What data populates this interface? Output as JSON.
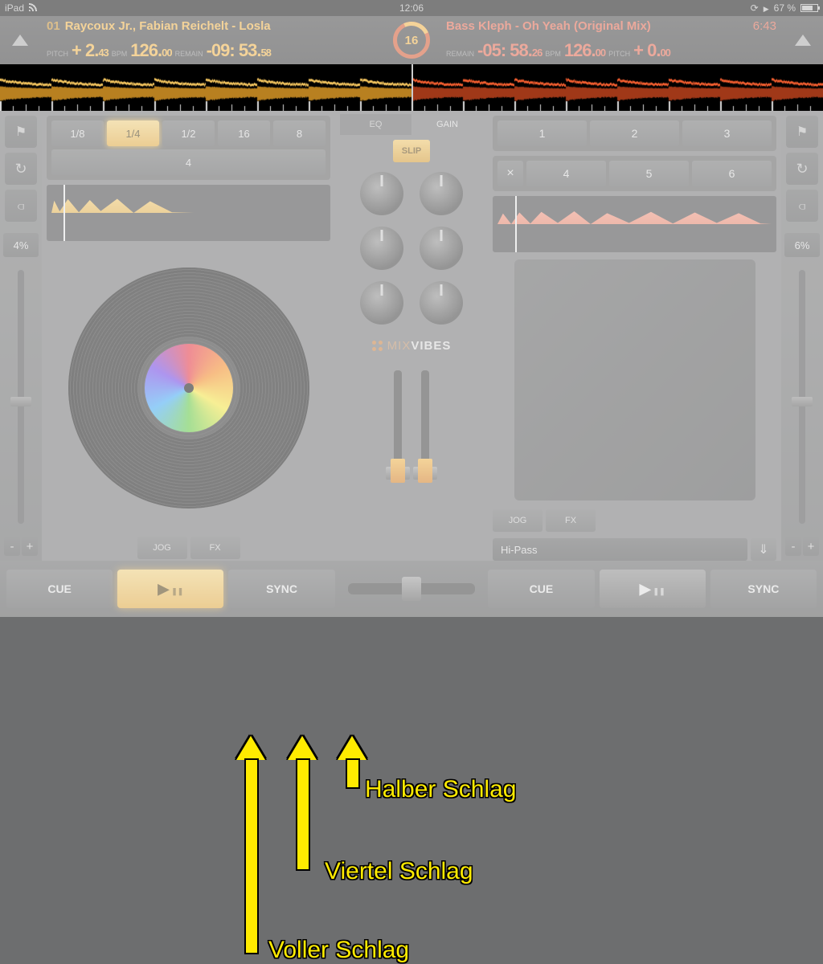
{
  "status": {
    "device": "iPad",
    "time": "12:06",
    "battery": "67 %"
  },
  "deckA": {
    "num": "01",
    "track": "Raycoux Jr., Fabian Reichelt - Losla",
    "pitch_lbl": "PITCH",
    "pitch": "+ 2.",
    "pitch_dec": "43",
    "bpm_lbl": "BPM",
    "bpm": "126.",
    "bpm_dec": "00",
    "remain_lbl": "REMAIN",
    "remain": "-09: 53.",
    "remain_dec": "58",
    "pct": "4%"
  },
  "deckB": {
    "track": "Bass Kleph - Oh Yeah (Original Mix)",
    "dur": "6:43",
    "remain_lbl": "REMAIN",
    "remain": "-05: 58.",
    "remain_dec": "26",
    "bpm_lbl": "BPM",
    "bpm": "126.",
    "bpm_dec": "00",
    "pitch_lbl": "PITCH",
    "pitch": "+ 0.",
    "pitch_dec": "00",
    "pct": "6%"
  },
  "ring": "16",
  "loops": {
    "r1": [
      "1/8",
      "1/4",
      "1/2"
    ],
    "r2": [
      "16",
      "8",
      "4"
    ]
  },
  "cues": {
    "r1": [
      "1",
      "2",
      "3"
    ],
    "r2": [
      "4",
      "5",
      "6"
    ],
    "close": "×"
  },
  "mixer": {
    "tab_eq": "EQ",
    "tab_gain": "GAIN",
    "slip": "SLIP"
  },
  "brand": {
    "a": "MIX",
    "b": "VIBES"
  },
  "deckbtns": {
    "jog": "JOG",
    "fx": "FX"
  },
  "fx": {
    "name": "Hi-Pass",
    "arrow": "⇓"
  },
  "transport": {
    "cue": "CUE",
    "sync": "SYNC"
  },
  "pm": {
    "minus": "-",
    "plus": "+"
  },
  "annot": {
    "a1": "Halber Schlag",
    "a2": "Viertel Schlag",
    "a3": "Voller Schlag"
  }
}
